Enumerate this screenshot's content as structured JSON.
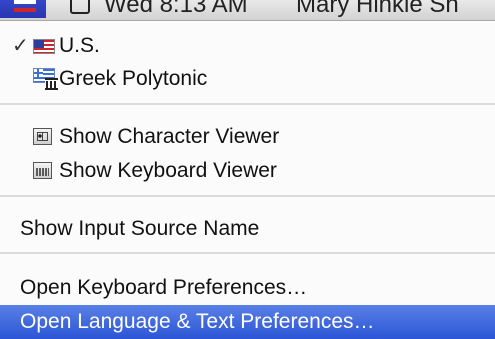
{
  "menubar": {
    "clock": "Wed 8:13 AM",
    "user": "Mary Hinkle Sh"
  },
  "menu": {
    "items": [
      {
        "label": "U.S.",
        "checked": true,
        "icon": "us-flag-icon"
      },
      {
        "label": "Greek Polytonic",
        "checked": false,
        "icon": "greek-flag-icon"
      },
      {
        "label": "Show Character Viewer",
        "icon": "character-viewer-icon"
      },
      {
        "label": "Show Keyboard Viewer",
        "icon": "keyboard-viewer-icon"
      },
      {
        "label": "Show Input Source Name"
      },
      {
        "label": "Open Keyboard Preferences…"
      },
      {
        "label": "Open Language & Text Preferences…",
        "selected": true
      }
    ],
    "checkmark": "✓"
  },
  "colors": {
    "selection": "#2b55d6",
    "separator": "#dcdcdc"
  }
}
